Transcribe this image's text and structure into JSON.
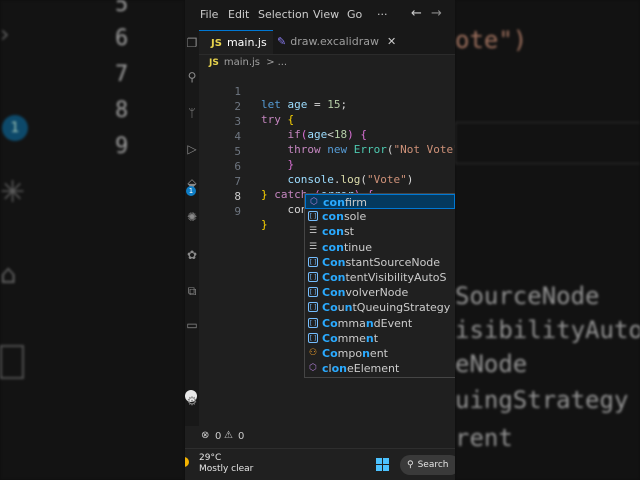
{
  "background_left": {
    "line_numbers": [
      "5",
      "6",
      "7",
      "8",
      "9"
    ],
    "badge": "1"
  },
  "background_right": {
    "fragments": [
      "ote\")",
      "SourceNode",
      "isibilityAutoS",
      "eNode",
      "uingStrategy",
      "rent"
    ]
  },
  "menu": {
    "items": [
      "File",
      "Edit",
      "Selection",
      "View",
      "Go",
      "···"
    ]
  },
  "nav": {
    "back": "←",
    "forward": "→"
  },
  "activity": {
    "scm_badge": "1"
  },
  "tabs": [
    {
      "badge": "JS",
      "label": "main.js",
      "active": true
    },
    {
      "label": "draw.excalidraw",
      "close": "✕",
      "active": false
    }
  ],
  "breadcrumb": {
    "badge": "JS",
    "file": "main.js",
    "sep": ">",
    "rest": "..."
  },
  "editor": {
    "line_numbers": [
      "1",
      "2",
      "3",
      "4",
      "5",
      "6",
      "7",
      "8",
      "9"
    ]
  },
  "suggestions": [
    {
      "label": "confirm",
      "kind": "cube"
    },
    {
      "label": "console",
      "kind": "var"
    },
    {
      "label": "const",
      "kind": "keyword"
    },
    {
      "label": "continue",
      "kind": "keyword"
    },
    {
      "label": "ConstantSourceNode",
      "kind": "var"
    },
    {
      "label": "ContentVisibilityAutoS",
      "kind": "var"
    },
    {
      "label": "ConvolverNode",
      "kind": "var"
    },
    {
      "label": "CountQueuingStrategy",
      "kind": "var"
    },
    {
      "label": "CommandEvent",
      "kind": "var"
    },
    {
      "label": "Comment",
      "kind": "var"
    },
    {
      "label": "Component",
      "kind": "snippet"
    },
    {
      "label": "cloneElement",
      "kind": "cube"
    }
  ],
  "status": {
    "errors": "0",
    "warnings": "0"
  },
  "taskbar": {
    "temperature": "29°C",
    "condition": "Mostly clear",
    "search": "Search"
  },
  "colors": {
    "accent": "#0078d4",
    "editor_bg": "#1f1f1f",
    "match": "#2aaaff"
  }
}
